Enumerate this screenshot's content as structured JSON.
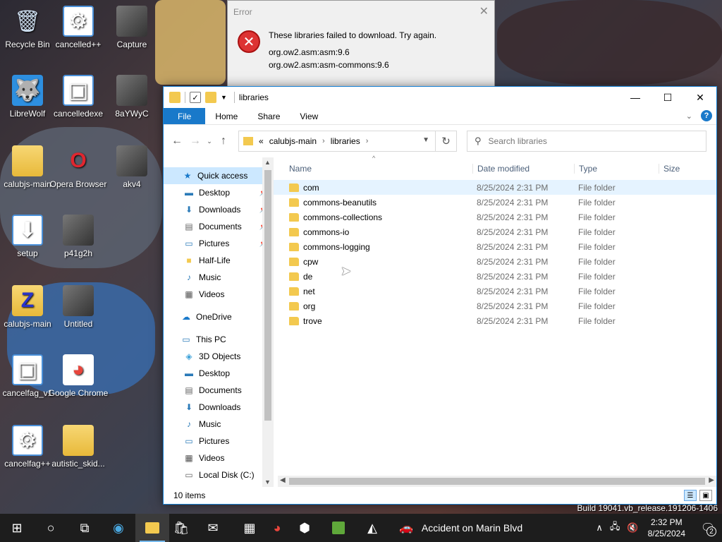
{
  "desktop": {
    "icons": [
      {
        "label": "Recycle Bin",
        "icon": "recycle-bin-icon"
      },
      {
        "label": "cancelled++",
        "icon": "gears-file-icon"
      },
      {
        "label": "Capture",
        "icon": "image-file-icon"
      },
      {
        "label": "LibreWolf",
        "icon": "librewolf-icon"
      },
      {
        "label": "cancelledexe",
        "icon": "app-window-icon"
      },
      {
        "label": "8aYWyC",
        "icon": "image-file-icon"
      },
      {
        "label": "calubjs-main",
        "icon": "folder-icon"
      },
      {
        "label": "Opera Browser",
        "icon": "opera-icon"
      },
      {
        "label": "akv4",
        "icon": "image-file-icon"
      },
      {
        "label": "setup",
        "icon": "setup-icon"
      },
      {
        "label": "p41g2h",
        "icon": "image-file-icon"
      },
      {
        "label": "calubjs-main",
        "icon": "zip-folder-icon"
      },
      {
        "label": "Untitled",
        "icon": "image-file-icon"
      },
      {
        "label": "cancelfag_v1",
        "icon": "app-window-icon"
      },
      {
        "label": "Google Chrome",
        "icon": "chrome-icon"
      },
      {
        "label": "cancelfag++",
        "icon": "gears-file-icon"
      },
      {
        "label": "autistic_skid...",
        "icon": "file-icon"
      }
    ],
    "build_text": "Build 19041.vb_release.191206-1406"
  },
  "error_dialog": {
    "title": "Error",
    "message": "These libraries failed to download. Try again.",
    "libraries": [
      "org.ow2.asm:asm:9.6",
      "org.ow2.asm:asm-commons:9.6"
    ]
  },
  "explorer": {
    "title": "libraries",
    "tabs": {
      "file": "File",
      "home": "Home",
      "share": "Share",
      "view": "View"
    },
    "breadcrumb": {
      "overflow": "«",
      "parent": "calubjs-main",
      "current": "libraries"
    },
    "search_placeholder": "Search libraries",
    "nav": {
      "quick_access": "Quick access",
      "quick_items": [
        {
          "label": "Desktop",
          "icon": "desktop-icon",
          "pinned": true
        },
        {
          "label": "Downloads",
          "icon": "downloads-icon",
          "pinned": true
        },
        {
          "label": "Documents",
          "icon": "documents-icon",
          "pinned": true
        },
        {
          "label": "Pictures",
          "icon": "pictures-icon",
          "pinned": true
        },
        {
          "label": "Half-Life",
          "icon": "folder-icon",
          "pinned": false
        },
        {
          "label": "Music",
          "icon": "music-icon",
          "pinned": false
        },
        {
          "label": "Videos",
          "icon": "videos-icon",
          "pinned": false
        }
      ],
      "onedrive": "OneDrive",
      "this_pc": "This PC",
      "pc_items": [
        {
          "label": "3D Objects",
          "icon": "3d-objects-icon"
        },
        {
          "label": "Desktop",
          "icon": "desktop-icon"
        },
        {
          "label": "Documents",
          "icon": "documents-icon"
        },
        {
          "label": "Downloads",
          "icon": "downloads-icon"
        },
        {
          "label": "Music",
          "icon": "music-icon"
        },
        {
          "label": "Pictures",
          "icon": "pictures-icon"
        },
        {
          "label": "Videos",
          "icon": "videos-icon"
        },
        {
          "label": "Local Disk (C:)",
          "icon": "drive-icon"
        }
      ]
    },
    "columns": {
      "name": "Name",
      "date": "Date modified",
      "type": "Type",
      "size": "Size"
    },
    "files": [
      {
        "name": "com",
        "date": "8/25/2024 2:31 PM",
        "type": "File folder"
      },
      {
        "name": "commons-beanutils",
        "date": "8/25/2024 2:31 PM",
        "type": "File folder"
      },
      {
        "name": "commons-collections",
        "date": "8/25/2024 2:31 PM",
        "type": "File folder"
      },
      {
        "name": "commons-io",
        "date": "8/25/2024 2:31 PM",
        "type": "File folder"
      },
      {
        "name": "commons-logging",
        "date": "8/25/2024 2:31 PM",
        "type": "File folder"
      },
      {
        "name": "cpw",
        "date": "8/25/2024 2:31 PM",
        "type": "File folder"
      },
      {
        "name": "de",
        "date": "8/25/2024 2:31 PM",
        "type": "File folder"
      },
      {
        "name": "net",
        "date": "8/25/2024 2:31 PM",
        "type": "File folder"
      },
      {
        "name": "org",
        "date": "8/25/2024 2:31 PM",
        "type": "File folder"
      },
      {
        "name": "trove",
        "date": "8/25/2024 2:31 PM",
        "type": "File folder"
      }
    ],
    "status": "10 items"
  },
  "taskbar": {
    "news": "Accident on Marin Blvd",
    "time": "2:32 PM",
    "date": "8/25/2024",
    "notifications": "2",
    "accent": "#76b9ed"
  }
}
